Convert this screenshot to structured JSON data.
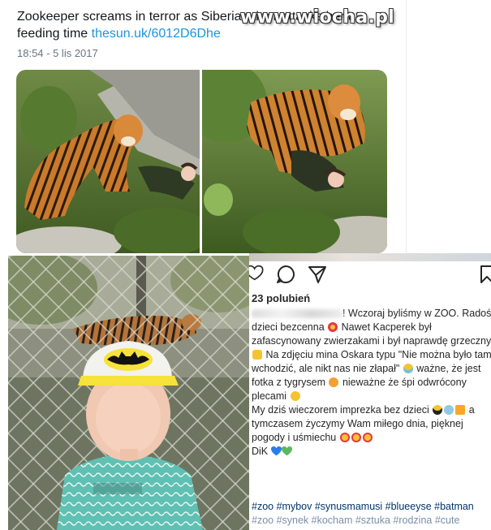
{
  "tweet": {
    "text": "Zookeeper screams in terror as Siberian tiger attacks her at feeding time",
    "link": "thesun.uk/6012D6Dhe",
    "timestamp": "18:54 - 5 lis 2017"
  },
  "watermark": "www.wiocha.pl",
  "instagram": {
    "likes": "23 polubień",
    "caption_lines": [
      "! Wczoraj byliśmy w ZOO. Radoś",
      "dzieci bezcenna",
      " Nawet Kacperek był",
      "zafascynowany zwierzakami i był naprawdę grzeczny",
      " Na zdjęciu mina Oskara typu \"Nie można było tam",
      "wchodzić, ale nikt nas nie złapał\"",
      " ważne, że jest",
      "fotka z tygrysem",
      " nieważne że śpi odwrócony",
      "plecami",
      "My dziś wieczorem imprezka bez dzieci",
      " a",
      "tymczasem życzymy Wam miłego dnia, pięknej",
      "pogody i uśmiechu",
      "DiK"
    ],
    "hashtags": "#zoo #mybov #synusmamusi #blueeyse #batman",
    "hashtags_line2": "#zoo #synek #kocham #sztuka #rodzina #cute"
  },
  "colors": {
    "link": "#1b95e0",
    "meta": "#657786",
    "insta_text": "#262626",
    "insta_hashtag": "#003569"
  },
  "icons": [
    "heart-icon",
    "comment-icon",
    "share-icon",
    "bookmark-icon"
  ]
}
